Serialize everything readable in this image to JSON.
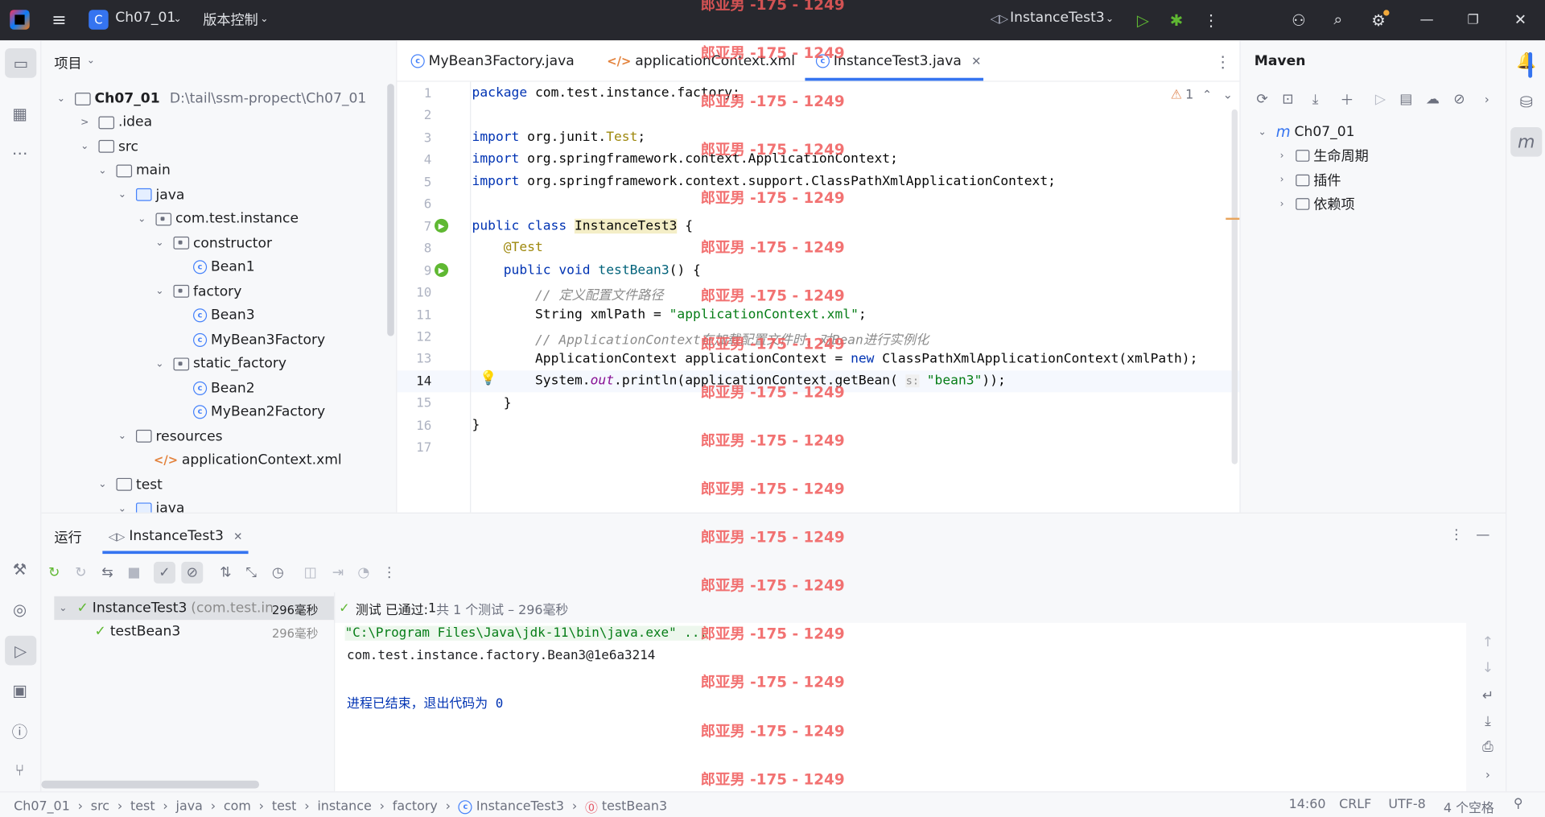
{
  "titlebar": {
    "project_badge": "C",
    "project_name": "Ch07_01",
    "vcs": "版本控制",
    "run_config": "InstanceTest3"
  },
  "project_panel": {
    "title": "项目",
    "root_name": "Ch07_01",
    "root_path": "D:\\tail\\ssm-propect\\Ch07_01",
    "items": [
      {
        "label": ".idea",
        "type": "folder"
      },
      {
        "label": "src",
        "type": "folder"
      },
      {
        "label": "main",
        "type": "folder"
      },
      {
        "label": "java",
        "type": "folder-blue"
      },
      {
        "label": "com.test.instance",
        "type": "package"
      },
      {
        "label": "constructor",
        "type": "package"
      },
      {
        "label": "Bean1",
        "type": "class"
      },
      {
        "label": "factory",
        "type": "package"
      },
      {
        "label": "Bean3",
        "type": "class"
      },
      {
        "label": "MyBean3Factory",
        "type": "class"
      },
      {
        "label": "static_factory",
        "type": "package"
      },
      {
        "label": "Bean2",
        "type": "class"
      },
      {
        "label": "MyBean2Factory",
        "type": "class"
      },
      {
        "label": "resources",
        "type": "folder"
      },
      {
        "label": "applicationContext.xml",
        "type": "xml"
      },
      {
        "label": "test",
        "type": "folder"
      },
      {
        "label": "java",
        "type": "folder-blue"
      }
    ]
  },
  "tabs": [
    {
      "label": "MyBean3Factory.java"
    },
    {
      "label": "applicationContext.xml"
    },
    {
      "label": "InstanceTest3.java"
    }
  ],
  "editor": {
    "warning_count": "1",
    "line_numbers": [
      "1",
      "2",
      "3",
      "4",
      "5",
      "6",
      "7",
      "8",
      "9",
      "10",
      "11",
      "12",
      "13",
      "14",
      "15",
      "16",
      "17"
    ],
    "l1_kw": "package",
    "l1_rest": " com.test.instance.factory;",
    "l3_kw": "import",
    "l3_a": " org.junit.",
    "l3_b": "Test",
    "l3_c": ";",
    "l4_kw": "import",
    "l4_rest": " org.springframework.context.ApplicationContext;",
    "l5_kw": "import",
    "l5_rest": " org.springframework.context.support.ClassPathXmlApplicationContext;",
    "l7_kw": "public class",
    "l7_name": "InstanceTest3",
    "l7_rest": " {",
    "l8_ann": "@Test",
    "l9_kw": "public void",
    "l9_name": "testBean3",
    "l9_rest": "() {",
    "l10_cmt": "// 定义配置文件路径",
    "l11_a": "String xmlPath = ",
    "l11_str": "\"applicationContext.xml\"",
    "l11_c": ";",
    "l12_cmt": "// ApplicationContext在加载配置文件时，对Bean进行实例化",
    "l13_a": "ApplicationContext applicationContext = ",
    "l13_kw": "new",
    "l13_b": " ClassPathXmlApplicationContext(xmlPath);",
    "l14_a": "System.",
    "l14_it": "out",
    "l14_b": ".println(applicationContext.getBean( ",
    "l14_hint": "s:",
    "l14_str": "\"bean3\"",
    "l14_c": "));",
    "l15": "}",
    "l16": "}"
  },
  "maven": {
    "title": "Maven",
    "project": "Ch07_01",
    "items": [
      "生命周期",
      "插件",
      "依赖项"
    ]
  },
  "run": {
    "tab_run": "运行",
    "tab_config": "InstanceTest3",
    "status_prefix": "测试 已通过: ",
    "status_count": "1",
    "status_suffix": "共 1 个测试 – 296毫秒",
    "tree": [
      {
        "name": "InstanceTest3",
        "detail": "(com.test.inst",
        "time": "296毫秒"
      },
      {
        "name": "testBean3",
        "detail": "",
        "time": "296毫秒"
      }
    ],
    "console": [
      "\"C:\\Program Files\\Java\\jdk-11\\bin\\java.exe\" ...",
      "com.test.instance.factory.Bean3@1e6a3214",
      "",
      "进程已结束，退出代码为 0"
    ]
  },
  "statusbar": {
    "crumbs": [
      "Ch07_01",
      "src",
      "test",
      "java",
      "com",
      "test",
      "instance",
      "factory",
      "InstanceTest3",
      "testBean3"
    ],
    "position": "14:60",
    "line_sep": "CRLF",
    "encoding": "UTF-8",
    "indent": "4 个空格"
  },
  "watermark": "郎亚男 -175 - 1249",
  "colors": {
    "accent": "#3574f0",
    "keyword": "#0033b3",
    "string": "#067d17",
    "success": "#5fb832"
  }
}
